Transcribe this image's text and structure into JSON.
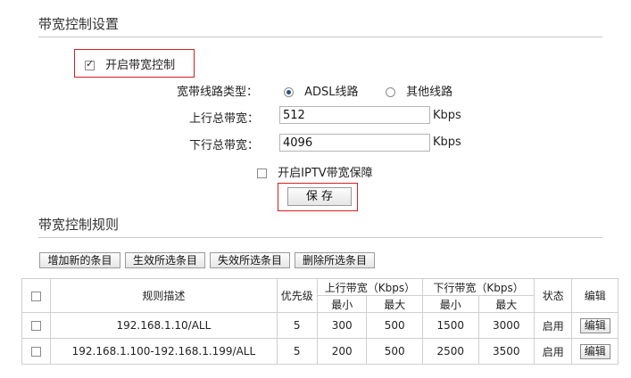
{
  "bandwidth_settings": {
    "title": "带宽控制设置",
    "enable_label": "开启带宽控制",
    "enable_checked": true,
    "line_type_label": "宽带线路类型：",
    "line_types": [
      {
        "label": "ADSL线路",
        "selected": true
      },
      {
        "label": "其他线路",
        "selected": false
      }
    ],
    "upstream_label": "上行总带宽：",
    "upstream_value": "512",
    "downstream_label": "下行总带宽：",
    "downstream_value": "4096",
    "unit": "Kbps",
    "iptv_label": "开启IPTV带宽保障",
    "iptv_checked": false,
    "save_label": "保 存"
  },
  "rules_section": {
    "title": "带宽控制规则",
    "buttons": [
      "增加新的条目",
      "生效所选条目",
      "失效所选条目",
      "删除所选条目"
    ],
    "headers": {
      "desc": "规则描述",
      "priority": "优先级",
      "up": "上行带宽（Kbps）",
      "down": "下行带宽（Kbps）",
      "min": "最小",
      "max": "最大",
      "status": "状态",
      "edit": "编辑"
    },
    "rows": [
      {
        "desc": "192.168.1.10/ALL",
        "priority": "5",
        "up_min": "300",
        "up_max": "500",
        "down_min": "1500",
        "down_max": "3000",
        "status": "启用",
        "edit": "编辑"
      },
      {
        "desc": "192.168.1.100-192.168.1.199/ALL",
        "priority": "5",
        "up_min": "200",
        "up_max": "500",
        "down_min": "2500",
        "down_max": "3500",
        "status": "启用",
        "edit": "编辑"
      }
    ]
  }
}
